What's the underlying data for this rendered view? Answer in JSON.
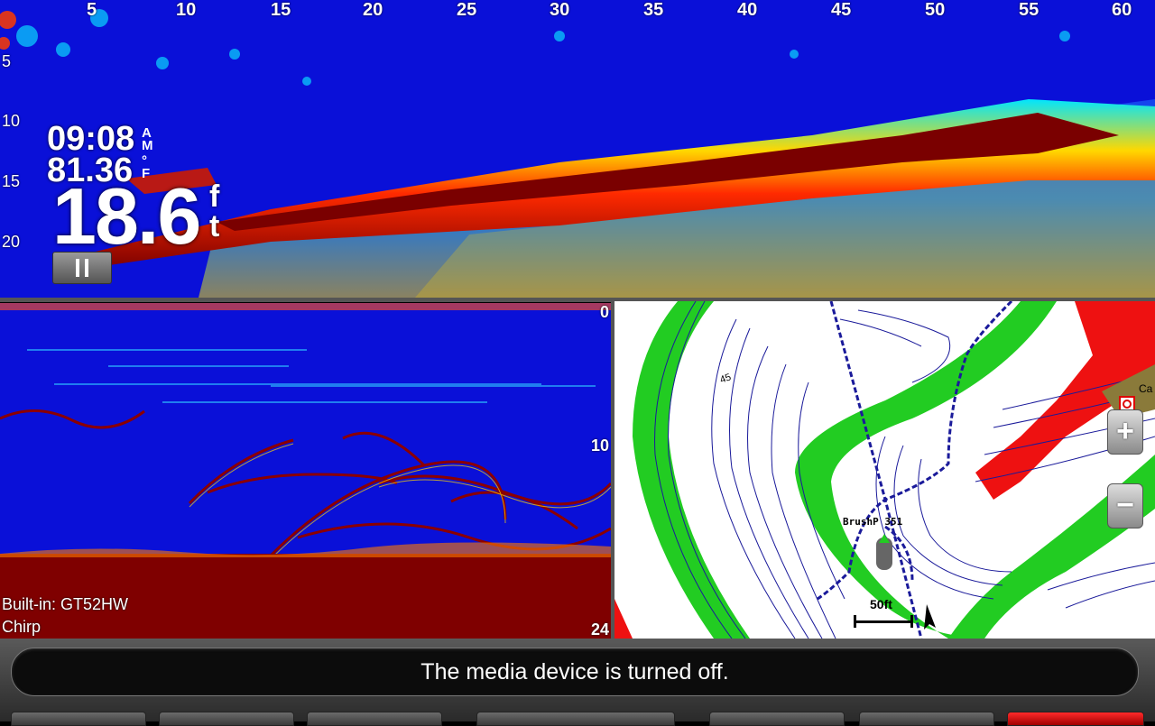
{
  "distance_scale": [
    "5",
    "10",
    "15",
    "20",
    "25",
    "30",
    "35",
    "40",
    "45",
    "50",
    "55",
    "60"
  ],
  "depth_scale_top": [
    "5",
    "10",
    "15",
    "20"
  ],
  "readouts": {
    "time": "09:08",
    "time_ampm_a": "A",
    "time_ampm_m": "M",
    "water_temp": "81.36",
    "temp_degree": "°",
    "temp_unit": "F",
    "depth": "18.6",
    "depth_unit_f": "f",
    "depth_unit_t": "t"
  },
  "sonar_left": {
    "scale": [
      "0",
      "10",
      "24"
    ],
    "transducer": "Built-in: GT52HW",
    "frequency_mode": "Chirp"
  },
  "map": {
    "contour_label": "45",
    "waypoint_label": "BrushP 351",
    "scale_label": "50ft",
    "city_label": "Ca",
    "zoom_in_symbol": "+",
    "zoom_out_symbol": "−"
  },
  "status": {
    "message": "The media device is turned off."
  },
  "colors": {
    "sonar_background": "#0a10d8",
    "sonar_strong_return": "#8b0000",
    "depth_band": "#22cc22",
    "land": "#ee1111",
    "contour_line": "#1a1a9a"
  }
}
